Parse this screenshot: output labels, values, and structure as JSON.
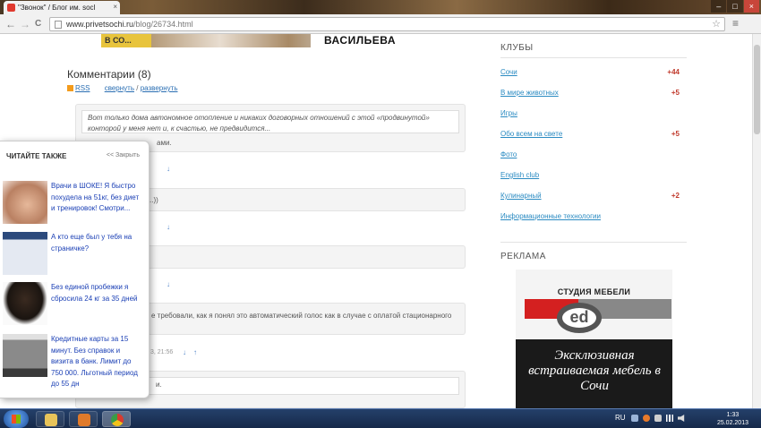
{
  "browser": {
    "tab_title": "\"Звонок\" / Блог им. socl",
    "tab_close": "×",
    "url_domain": "www.privetsochi.ru",
    "url_path": "/blog/26734.html",
    "back": "←",
    "forward": "→",
    "reload": "C",
    "star": "☆",
    "wrench": "≡",
    "win_min": "–",
    "win_max": "□",
    "win_close": "×"
  },
  "banner": {
    "left_text": "В СО...",
    "name": "ВАСИЛЬЕВА"
  },
  "comments": {
    "title": "Комментарии (8)",
    "rss": "RSS",
    "collapse": "свернуть",
    "slash": "/",
    "expand": "развернуть",
    "c1_quote": "Вот только дома автономное отопление и никаких договорных отношений с этой «продвинутой» конторой у меня нет и, к счастью, не предвидится...",
    "c1_text": "ами.",
    "c2_text": "..))",
    "c4_text": "е требовали, как я понял это автоматический голос как в случае с оплатой стационарного",
    "c5_text": "и.",
    "meta_time": "3, 21:56",
    "arrow_down": "↓",
    "arrow_up": "↑"
  },
  "clubs": {
    "title": "КЛУБЫ",
    "items": [
      {
        "label": "Сочи",
        "count": "+44"
      },
      {
        "label": "В мире животных",
        "count": "+5"
      },
      {
        "label": "Игры",
        "count": ""
      },
      {
        "label": "Обо всем на свете",
        "count": "+5"
      },
      {
        "label": "Фото",
        "count": ""
      },
      {
        "label": "English club",
        "count": ""
      },
      {
        "label": "Кулинарный",
        "count": "+2"
      },
      {
        "label": "Информационные технологии",
        "count": ""
      }
    ]
  },
  "ads": {
    "title": "РЕКЛАМА",
    "studio": "СТУДИЯ МЕБЕЛИ",
    "logo": "ed",
    "slogan": "Эксклюзивная встраиваемая мебель в Сочи"
  },
  "popup": {
    "title": "ЧИТАЙТЕ ТАКЖЕ",
    "close": "<< Закрыть",
    "items": [
      {
        "text": "Врачи в ШОКЕ! Я быстро похудела на 51кг, без диет и тренировок! Смотри...",
        "thumb_color": "#d9a88a"
      },
      {
        "text": "А кто еще был у тебя на страничке?",
        "thumb_color": "#8aa8d0"
      },
      {
        "text": "Без единой пробежки я сбросила 24 кг за 35 дней",
        "thumb_color": "#5a4436"
      },
      {
        "text": "Кредитные карты за 15 минут. Без справок и визита в банк. Лимит до 750 000. Льготный период до 55 дн",
        "thumb_color": "#6e6e6e"
      }
    ]
  },
  "taskbar": {
    "lang": "RU",
    "time": "1:33",
    "date": "25.02.2013"
  }
}
